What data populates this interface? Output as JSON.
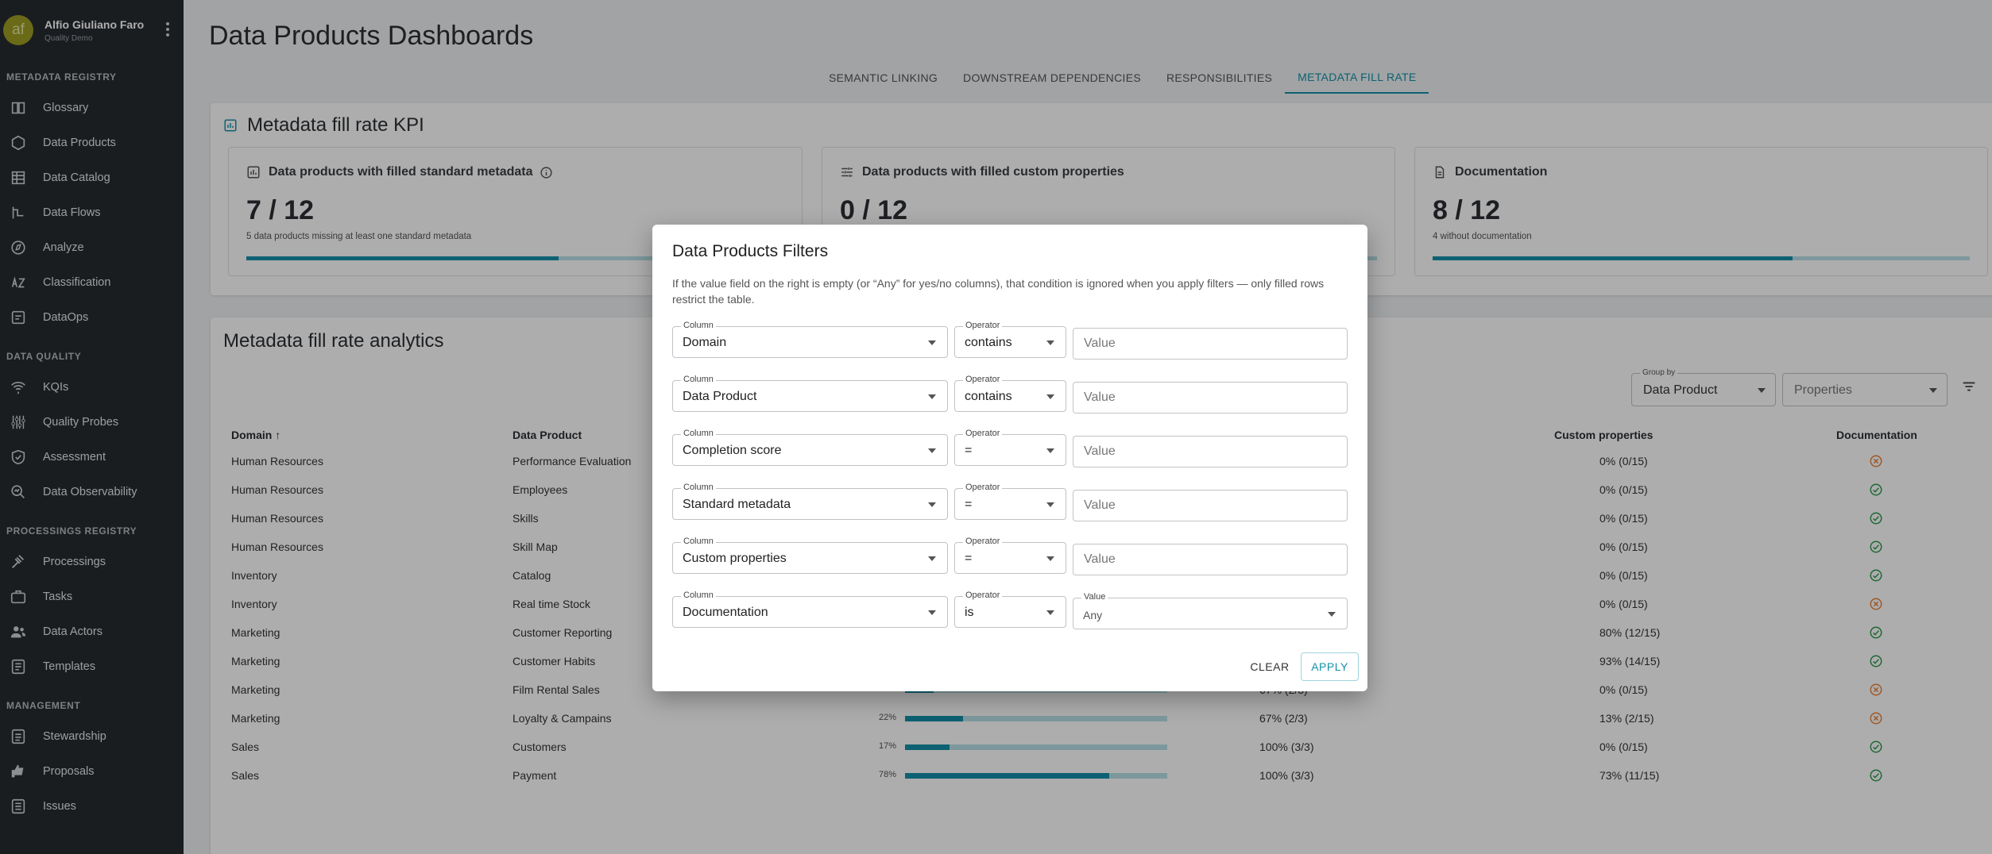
{
  "user": {
    "initials": "af",
    "name": "Alfio Giuliano Faro",
    "org": "Quality Demo"
  },
  "sidebar": {
    "sections": [
      {
        "title": "Metadata Registry",
        "items": [
          {
            "label": "Glossary",
            "icon": "book-icon"
          },
          {
            "label": "Data Products",
            "icon": "hexagon-icon"
          },
          {
            "label": "Data Catalog",
            "icon": "catalog-icon"
          },
          {
            "label": "Data Flows",
            "icon": "flow-icon"
          },
          {
            "label": "Analyze",
            "icon": "compass-icon"
          },
          {
            "label": "Classification",
            "icon": "sort-az-icon"
          },
          {
            "label": "DataOps",
            "icon": "dataops-icon"
          }
        ]
      },
      {
        "title": "Data Quality",
        "items": [
          {
            "label": "KQIs",
            "icon": "signal-icon"
          },
          {
            "label": "Quality Probes",
            "icon": "probes-icon"
          },
          {
            "label": "Assessment",
            "icon": "shield-check-icon"
          },
          {
            "label": "Data Observability",
            "icon": "observe-icon"
          }
        ]
      },
      {
        "title": "Processings Registry",
        "items": [
          {
            "label": "Processings",
            "icon": "gavel-icon"
          },
          {
            "label": "Tasks",
            "icon": "briefcase-icon"
          },
          {
            "label": "Data Actors",
            "icon": "people-icon"
          },
          {
            "label": "Templates",
            "icon": "template-icon"
          }
        ]
      },
      {
        "title": "Management",
        "items": [
          {
            "label": "Stewardship",
            "icon": "stewardship-icon"
          },
          {
            "label": "Proposals",
            "icon": "thumbs-icon"
          },
          {
            "label": "Issues",
            "icon": "issues-icon"
          }
        ]
      }
    ]
  },
  "page": {
    "title": "Data Products Dashboards",
    "tabs": [
      {
        "label": "Semantic Linking",
        "active": false
      },
      {
        "label": "Downstream Dependencies",
        "active": false
      },
      {
        "label": "Responsibilities",
        "active": false
      },
      {
        "label": "Metadata Fill Rate",
        "active": true
      }
    ]
  },
  "kpi": {
    "title": "Metadata fill rate KPI",
    "boxes": [
      {
        "label": "Data products with filled standard metadata",
        "value": "7 / 12",
        "sub": "5 data products missing at least one standard metadata",
        "fill": 0.58
      },
      {
        "label": "Data products with filled custom properties",
        "value": "0 / 12",
        "sub": "",
        "fill": 0
      },
      {
        "label": "Documentation",
        "value": "8 / 12",
        "sub": "4 without documentation",
        "fill": 0.67
      }
    ]
  },
  "analytics": {
    "title": "Metadata fill rate analytics",
    "group_by": {
      "label": "Group by",
      "value": "Data Product"
    },
    "properties_placeholder": "Properties",
    "columns": {
      "domain": "Domain",
      "product": "Data Product",
      "custom": "Custom properties",
      "doc": "Documentation"
    },
    "rows": [
      {
        "domain": "Human Resources",
        "product": "Performance Evaluation",
        "score": "",
        "fill": null,
        "standard": "",
        "custom": "0% (0/15)",
        "doc": "missing"
      },
      {
        "domain": "Human Resources",
        "product": "Employees",
        "score": "",
        "fill": null,
        "standard": "",
        "custom": "0% (0/15)",
        "doc": "ok"
      },
      {
        "domain": "Human Resources",
        "product": "Skills",
        "score": "",
        "fill": null,
        "standard": "",
        "custom": "0% (0/15)",
        "doc": "ok"
      },
      {
        "domain": "Human Resources",
        "product": "Skill Map",
        "score": "",
        "fill": null,
        "standard": "",
        "custom": "0% (0/15)",
        "doc": "ok"
      },
      {
        "domain": "Inventory",
        "product": "Catalog",
        "score": "",
        "fill": null,
        "standard": "",
        "custom": "0% (0/15)",
        "doc": "ok"
      },
      {
        "domain": "Inventory",
        "product": "Real time Stock",
        "score": "",
        "fill": null,
        "standard": "",
        "custom": "0% (0/15)",
        "doc": "missing"
      },
      {
        "domain": "Marketing",
        "product": "Customer Reporting",
        "score": "",
        "fill": null,
        "standard": "",
        "custom": "80% (12/15)",
        "doc": "ok"
      },
      {
        "domain": "Marketing",
        "product": "Customer Habits",
        "score": "",
        "fill": null,
        "standard": "",
        "custom": "93% (14/15)",
        "doc": "ok"
      },
      {
        "domain": "Marketing",
        "product": "Film Rental Sales",
        "score": "11%",
        "fill": 0.11,
        "standard": "67% (2/3)",
        "custom": "0% (0/15)",
        "doc": "missing"
      },
      {
        "domain": "Marketing",
        "product": "Loyalty & Campains",
        "score": "22%",
        "fill": 0.22,
        "standard": "67% (2/3)",
        "custom": "13% (2/15)",
        "doc": "missing"
      },
      {
        "domain": "Sales",
        "product": "Customers",
        "score": "17%",
        "fill": 0.17,
        "standard": "100% (3/3)",
        "custom": "0% (0/15)",
        "doc": "ok"
      },
      {
        "domain": "Sales",
        "product": "Payment",
        "score": "78%",
        "fill": 0.78,
        "standard": "100% (3/3)",
        "custom": "73% (11/15)",
        "doc": "ok"
      }
    ]
  },
  "dialog": {
    "title": "Data Products Filters",
    "description": "If the value field on the right is empty (or “Any” for yes/no columns), that condition is ignored when you apply filters — only filled rows restrict the table.",
    "column_label": "Column",
    "operator_label": "Operator",
    "value_label": "Value",
    "value_placeholder": "Value",
    "filters": [
      {
        "column": "Domain",
        "operator": "contains"
      },
      {
        "column": "Data Product",
        "operator": "contains"
      },
      {
        "column": "Completion score",
        "operator": "="
      },
      {
        "column": "Standard metadata",
        "operator": "="
      },
      {
        "column": "Custom properties",
        "operator": "="
      },
      {
        "column": "Documentation",
        "operator": "is",
        "value_select": "Any"
      }
    ],
    "clear_label": "Clear",
    "apply_label": "Apply"
  },
  "colors": {
    "accent": "#1490a8",
    "ok": "#2e9a4e",
    "missing": "#e8833a",
    "sidebar": "#272b30"
  }
}
